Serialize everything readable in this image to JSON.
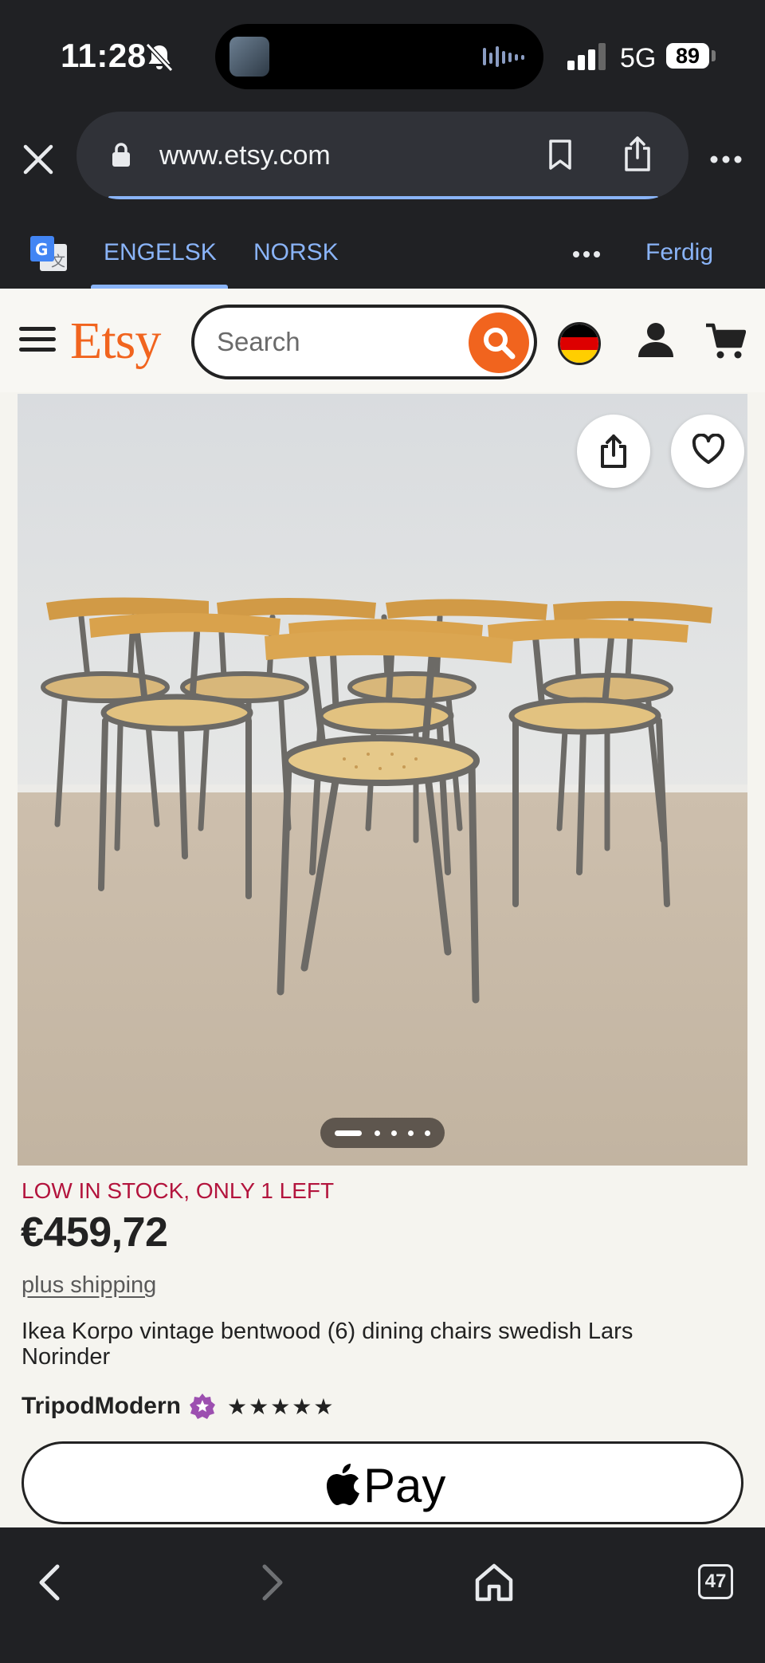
{
  "status_bar": {
    "time": "11:28",
    "network": "5G",
    "battery": "89"
  },
  "browser": {
    "url": "www.etsy.com"
  },
  "translate_bar": {
    "tabs": [
      {
        "label": "ENGELSK",
        "active": true
      },
      {
        "label": "NORSK",
        "active": false
      }
    ],
    "done_label": "Ferdig"
  },
  "etsy": {
    "logo": "Etsy",
    "search_placeholder": "Search",
    "accent": "#f1641e"
  },
  "product": {
    "image_count": 5,
    "active_image": 1,
    "stock_text": "LOW IN STOCK, ONLY 1 LEFT",
    "price": "€459,72",
    "shipping": "plus shipping",
    "title": "Ikea Korpo vintage bentwood (6) dining chairs swedish Lars Norinder",
    "shop_name": "TripodModern",
    "rating_stars": "★★★★★",
    "pay_label": "Pay"
  },
  "toolbar": {
    "tab_count": "47"
  }
}
